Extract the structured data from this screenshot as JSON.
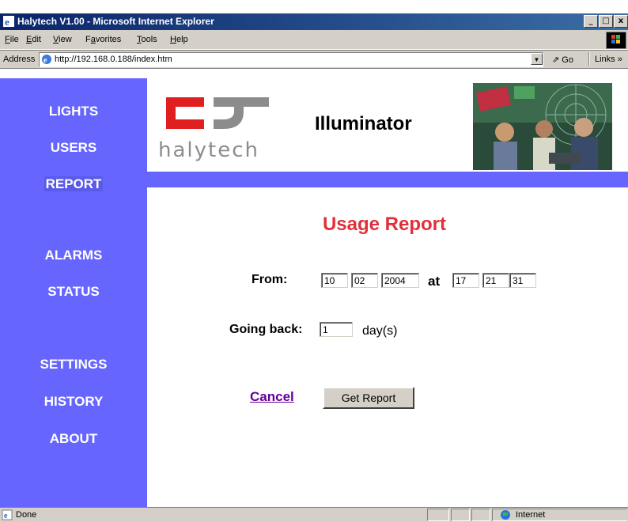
{
  "window": {
    "title": "Halytech V1.00 - Microsoft Internet Explorer",
    "minimize": "_",
    "maximize": "□",
    "close": "x"
  },
  "menubar": {
    "items": [
      {
        "key": "F",
        "rest": "ile"
      },
      {
        "key": "E",
        "rest": "dit"
      },
      {
        "key": "V",
        "rest": "iew"
      },
      {
        "pre": "F",
        "key": "a",
        "rest": "vorites"
      },
      {
        "key": "T",
        "rest": "ools"
      },
      {
        "key": "H",
        "rest": "elp"
      }
    ]
  },
  "address": {
    "label": "Address",
    "url": "http://192.168.0.188/index.htm",
    "go": "Go",
    "links": "Links »"
  },
  "nav": {
    "items": [
      {
        "label": "LIGHTS"
      },
      {
        "label": "USERS"
      },
      {
        "label": "REPORT"
      },
      {
        "label": "ALARMS"
      },
      {
        "label": "STATUS"
      },
      {
        "label": "SETTINGS"
      },
      {
        "label": "HISTORY"
      },
      {
        "label": "ABOUT"
      }
    ],
    "active": "REPORT"
  },
  "header": {
    "logo_text": "halytech",
    "app_title": "Illuminator"
  },
  "report": {
    "title": "Usage Report",
    "from_label": "From:",
    "from_day": "10",
    "from_month": "02",
    "from_year": "2004",
    "at_label": "at",
    "from_hour": "17",
    "from_minute": "21",
    "from_second": "31",
    "going_back_label": "Going back:",
    "going_back_value": "1",
    "going_back_unit": "day(s)",
    "cancel": "Cancel",
    "get_report": "Get Report"
  },
  "statusbar": {
    "status": "Done",
    "zone": "Internet"
  },
  "colors": {
    "nav_bg": "#6666ff",
    "title_red": "#e0303a",
    "logo_red": "#e02020",
    "link_visited": "#660099"
  }
}
